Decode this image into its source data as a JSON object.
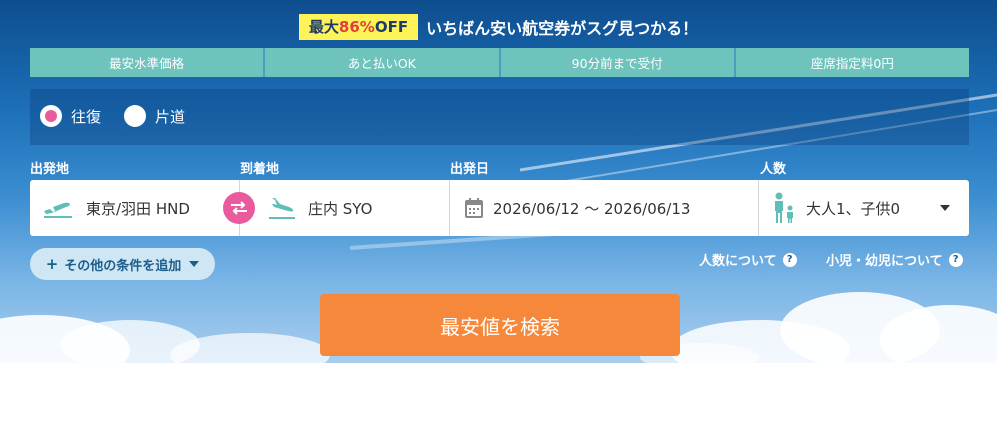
{
  "promo": {
    "badge_prefix": "最大",
    "badge_percent": "86%",
    "badge_suffix": "OFF",
    "text": "いちばん安い航空券がスグ見つかる！"
  },
  "features": [
    "最安水準価格",
    "あと払いOK",
    "90分前まで受付",
    "座席指定料0円"
  ],
  "trip_type": {
    "round_trip": "往復",
    "one_way": "片道",
    "selected": "round_trip"
  },
  "labels": {
    "departure": "出発地",
    "arrival": "到着地",
    "date": "出発日",
    "passengers": "人数"
  },
  "form": {
    "departure_value": "東京/羽田 HND",
    "arrival_value": "庄内 SYO",
    "date_value": "2026/06/12 〜 2026/06/13",
    "passengers_value": "大人1、子供0"
  },
  "more_conditions": "その他の条件を追加",
  "help_links": {
    "passengers": "人数について",
    "children": "小児・幼児について"
  },
  "search_button": "最安値を検索",
  "colors": {
    "feature_bg": "#6ec3bd",
    "swap": "#ea5b9d",
    "search": "#f5883a",
    "icon_teal": "#5fbfb6",
    "badge": "#fff35a"
  }
}
